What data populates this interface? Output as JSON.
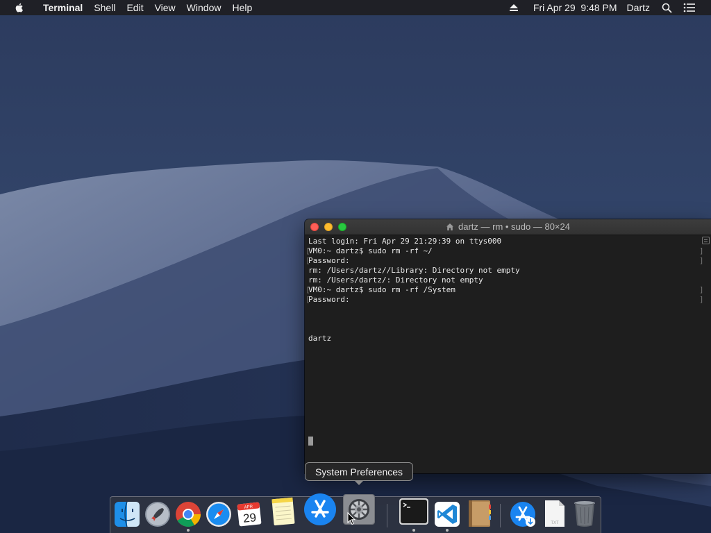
{
  "menubar": {
    "app_name": "Terminal",
    "menus": [
      "Shell",
      "Edit",
      "View",
      "Window",
      "Help"
    ],
    "datetime": "Fri Apr 29  9:48 PM",
    "user": "Dartz"
  },
  "terminal": {
    "title": "dartz — rm • sudo — 80×24",
    "lines": [
      "Last login: Fri Apr 29 21:29:39 on ttys000",
      "VM0:~ dartz$ sudo rm -rf ~/",
      "Password:",
      "rm: /Users/dartz//Library: Directory not empty",
      "rm: /Users/dartz/: Directory not empty",
      "VM0:~ dartz$ sudo rm -rf /System",
      "Password:",
      "",
      "",
      "",
      "dartz"
    ]
  },
  "tooltip": {
    "text": "System Preferences"
  },
  "dock": {
    "calendar_month": "APR",
    "calendar_day": "29",
    "file_ext": "TXT",
    "items": [
      "finder-icon",
      "launchpad-icon",
      "chrome-icon",
      "safari-icon",
      "calendar-icon",
      "notes-icon",
      "app-store-icon",
      "system-preferences-icon",
      "terminal-icon",
      "vscode-icon",
      "contacts-icon",
      "app-store-download-icon",
      "text-file-icon",
      "trash-icon"
    ]
  }
}
